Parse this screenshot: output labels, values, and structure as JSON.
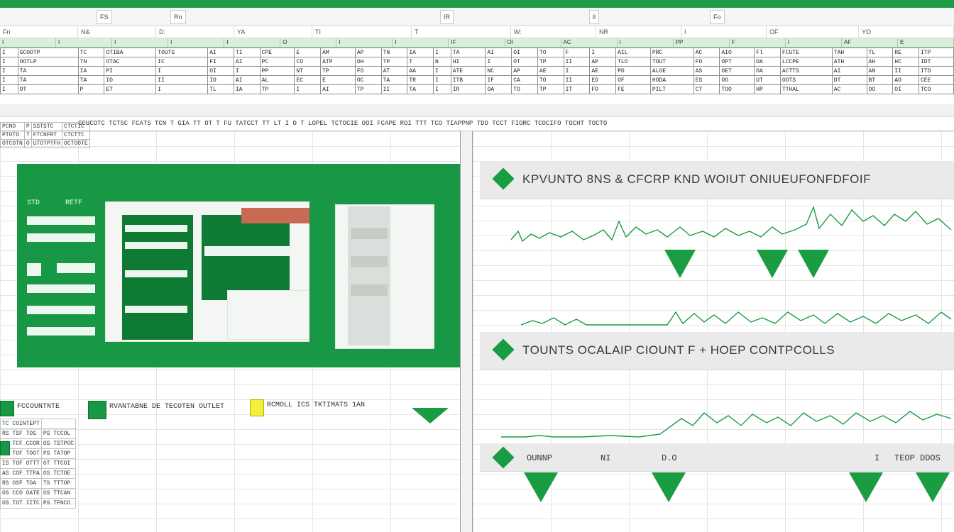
{
  "app": {
    "accent": "#1a9c42",
    "accent_dark": "#0f7a33",
    "header_green": "#d9efd9"
  },
  "ribbon": {
    "buttons": [
      "FS",
      "Rn",
      "IR",
      "ll",
      "Fo"
    ]
  },
  "formula_bar": {
    "cells": [
      "Fn",
      "N&",
      "D:",
      "YA",
      "TI",
      "T",
      "W:",
      "NR",
      "I",
      "OF",
      "YO"
    ]
  },
  "header_row": {
    "cells": [
      "I",
      "I",
      "I",
      "I",
      "I",
      "O",
      "I",
      "I",
      "IF",
      "OI",
      "AC",
      "I",
      "PP",
      "F",
      "I",
      "AF",
      "E"
    ]
  },
  "top_table": {
    "rows": [
      [
        "I",
        "GCOOTP",
        "TC",
        "OTIBA",
        "TOUTS",
        "AI",
        "TI",
        "CPE",
        "E",
        "AM",
        "AP",
        "TN",
        "IA",
        "I",
        "TA",
        "AI",
        "OI",
        "TO",
        "F",
        "I",
        "AIL",
        "PRC",
        "AC",
        "AIO",
        "Fl",
        "FCUTE",
        "TAH",
        "TL",
        "RE",
        "ITP"
      ],
      [
        "I",
        "OOTLP",
        "TN",
        "OTAC",
        "IC",
        "FI",
        "AI",
        "PC",
        "CO",
        "ATP",
        "OH",
        "TP",
        "T",
        "N",
        "HI",
        "I",
        "OT",
        "TP",
        "II",
        "AP",
        "TLO",
        "TOUT",
        "FO",
        "OPT",
        "OA",
        "LCCPE",
        "ATH",
        "AH",
        "HC",
        "IDT"
      ],
      [
        "I",
        "TA",
        "IA",
        "PI",
        "I",
        "OI",
        "I",
        "PP",
        "NT",
        "TP",
        "FO",
        "AT",
        "AA",
        "I",
        "ATE",
        "NC",
        "AP",
        "AE",
        "I",
        "AE",
        "PD",
        "ALOE",
        "AS",
        "OET",
        "OA",
        "ACTTS",
        "AI",
        "AN",
        "II",
        "ITD"
      ],
      [
        "I",
        "TA",
        "TA",
        "IO",
        "II",
        "IO",
        "AI",
        "AL",
        "EC",
        "E",
        "OC",
        "TA",
        "TR",
        "I",
        "ITB",
        "IF",
        "CA",
        "TO",
        "II",
        "EO",
        "OF",
        "HODA",
        "ES",
        "OO",
        "UT",
        "OOTS",
        "DT",
        "BT",
        "AO",
        "CEE"
      ],
      [
        "I",
        "OT",
        "P",
        "ET",
        "I",
        "TL",
        "IA",
        "TP",
        "I",
        "AI",
        "TP",
        "II",
        "TA",
        "I",
        "IR",
        "OA",
        "TO",
        "TP",
        "IT",
        "FO",
        "FE",
        "PILT",
        "CT",
        "TOO",
        "HP",
        "TTHAL",
        "AC",
        "OO",
        "OI",
        "TCO"
      ]
    ]
  },
  "col_bar": {
    "text": "CCUCOTC TCTSC FCATS TCN T GIA TT OT T FU TATCCT TT LT I O T LOPEL TCTOCIE OOI FCAPE ROI TTT TCO TIAPPNP TDO TCCT FIORC TCOCIFO TOCHT TOCTO"
  },
  "side_table": {
    "rows": [
      [
        "PCNO",
        "P",
        "SSTSTC",
        "CTCTIC"
      ],
      [
        "PTOTO",
        "T",
        "FTCNFRT",
        "CTCTTC"
      ],
      [
        "OTCOTN",
        "O",
        "UTOTPTFH",
        "OCTOOTE"
      ]
    ]
  },
  "green_panel": {
    "label_a": "STD",
    "label_b": "RETF"
  },
  "bottom_labels": {
    "label1": "FCCOUNTNTE",
    "label2": "RVANTABNE DE TECOTEN OUTLET",
    "label3": "RCMOLL ICS TKTIMATS 1AN"
  },
  "bottom_table": {
    "rows": [
      [
        "TC COINTEPT",
        ""
      ],
      [
        "RS TSF TOS",
        "PS TCCOL"
      ],
      [
        "OS TCF CCOR",
        "OS TSTPOC"
      ],
      [
        "TS TOF TOOT",
        "PS TATOP"
      ],
      [
        "IS TOF OTTT",
        "OT TTCOI"
      ],
      [
        "AS COF TTPA",
        "OS TCTOE"
      ],
      [
        "RS OSF TOA",
        "TS TTTOP"
      ],
      [
        "OS CCO OATE",
        "OS TTCAN"
      ],
      [
        "OS TOT IITC",
        "PS TFNCO"
      ]
    ]
  },
  "sections": [
    {
      "title": "KPVUNTO  8NS  &  CFCRP KND WOIUT ONIUEUFONFDFOIF"
    },
    {
      "title": "TOUNTS OCALAIP  CIOUNT F  +  HOEP CONTPCOLLS"
    },
    {
      "title": "OUNNP   NI   D.O   I   TEOP DDOS"
    }
  ],
  "section3_labels": [
    "OUNNP",
    "NI",
    "D.O",
    "I",
    "TEOP DDOS"
  ]
}
